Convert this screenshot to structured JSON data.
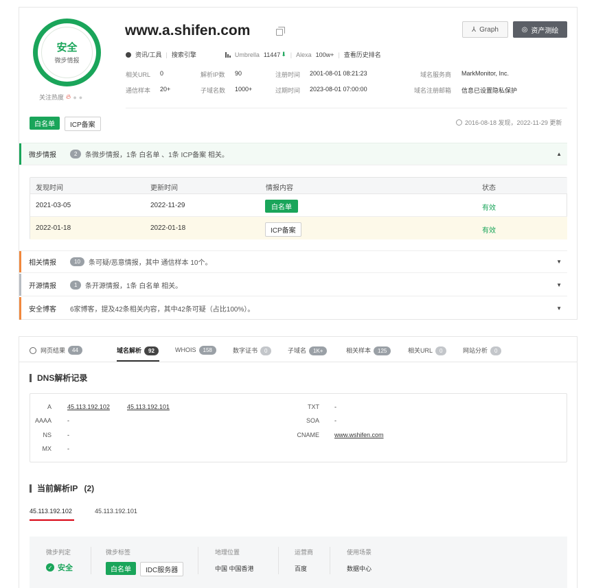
{
  "header": {
    "domain": "www.a.shifen.com",
    "safety_label": "安全",
    "safety_sub": "微步情报",
    "attention_label": "关注热度",
    "tools": "资讯/工具",
    "search_engine": "搜索引擎",
    "umbrella_label": "Umbrella",
    "umbrella_value": "11447",
    "alexa_label": "Alexa",
    "alexa_value": "100w+",
    "history_rank": "查看历史排名",
    "graph_button": "Graph",
    "asset_button": "资产测绘"
  },
  "stats": {
    "related_url_label": "相关URL",
    "related_url_value": "0",
    "resolve_ip_label": "解析IP数",
    "resolve_ip_value": "90",
    "reg_time_label": "注册时间",
    "reg_time_value": "2001-08-01 08:21:23",
    "registrar_label": "域名服务商",
    "registrar_value": "MarkMonitor, Inc.",
    "comm_sample_label": "通信样本",
    "comm_sample_value": "20+",
    "subdomain_label": "子域名数",
    "subdomain_value": "1000+",
    "expire_label": "过期时间",
    "expire_value": "2023-08-01 07:00:00",
    "reg_email_label": "域名注册邮箱",
    "reg_email_value": "信息已设置隐私保护"
  },
  "tags": {
    "whitelist": "白名单",
    "icp": "ICP备案"
  },
  "timeline": "2016-08-18 发现，2022-11-29 更新",
  "sections": {
    "intel_title": "微步情报",
    "intel_count": "2",
    "intel_text": "条微步情报，1条 白名单 、1条 ICP备案 相关。",
    "related_title": "相关情报",
    "related_count": "10",
    "related_text": "条可疑/恶意情报，其中 通信样本 10个。",
    "open_title": "开源情报",
    "open_count": "1",
    "open_text": "条开源情报，1条 白名单 相关。",
    "blog_title": "安全博客",
    "blog_text": "6家博客，提及42条相关内容，其中42条可疑（占比100%）。"
  },
  "intel_table": {
    "headers": [
      "发现时间",
      "更新时间",
      "情报内容",
      "状态"
    ],
    "rows": [
      {
        "found": "2021-03-05",
        "updated": "2022-11-29",
        "content": "白名单",
        "status": "有效"
      },
      {
        "found": "2022-01-18",
        "updated": "2022-01-18",
        "content": "ICP备案",
        "status": "有效"
      }
    ]
  },
  "tabs": [
    {
      "label": "网页结果",
      "count": "44"
    },
    {
      "label": "域名解析",
      "count": "92"
    },
    {
      "label": "WHOIS",
      "count": "158"
    },
    {
      "label": "数字证书",
      "count": "0"
    },
    {
      "label": "子域名",
      "count": "1K+"
    },
    {
      "label": "相关样本",
      "count": "125"
    },
    {
      "label": "相关URL",
      "count": "0"
    },
    {
      "label": "网站分析",
      "count": "0"
    }
  ],
  "dns": {
    "title": "DNS解析记录",
    "a_label": "A",
    "a_values": [
      "45.113.192.102",
      "45.113.192.101"
    ],
    "aaaa_label": "AAAA",
    "aaaa_value": "-",
    "ns_label": "NS",
    "ns_value": "-",
    "mx_label": "MX",
    "mx_value": "-",
    "txt_label": "TXT",
    "txt_value": "-",
    "soa_label": "SOA",
    "soa_value": "-",
    "cname_label": "CNAME",
    "cname_value": "www.wshifen.com"
  },
  "current_ip": {
    "title": "当前解析IP",
    "count": "(2)",
    "ips": [
      "45.113.192.102",
      "45.113.192.101"
    ],
    "judge_label": "微步判定",
    "judge_value": "安全",
    "tags_label": "微步标签",
    "tag1": "白名单",
    "tag2": "IDC服务器",
    "geo_label": "地理位置",
    "geo_value": "中国 中国香港",
    "isp_label": "运营商",
    "isp_value": "百度",
    "scene_label": "使用场景",
    "scene_value": "数据中心"
  },
  "colors": {
    "green": "#1aa55a",
    "orange": "#f0883e",
    "red": "#d7000f",
    "dark_button": "#5b5f66"
  }
}
